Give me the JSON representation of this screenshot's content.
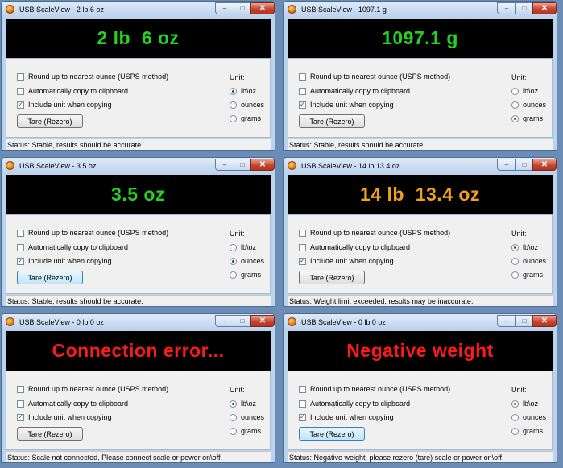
{
  "windows": [
    {
      "title": "USB ScaleView - 2 lb 6 oz",
      "display_text": "2 lb  6 oz",
      "display_color": "#22d322",
      "checkbox_round_label": "Round up to nearest ounce (USPS method)",
      "checkbox_round_checked": false,
      "checkbox_copy_label": "Automatically copy to clipboard",
      "checkbox_copy_checked": false,
      "checkbox_unit_label": "Include unit when copying",
      "checkbox_unit_checked": true,
      "unit_label": "Unit:",
      "radio_lboz_label": "lb\\oz",
      "radio_ounces_label": "ounces",
      "radio_grams_label": "grams",
      "selected_unit": "lb\\oz",
      "tare_label": "Tare (Rezero)",
      "status": "Status: Stable, results should be accurate."
    },
    {
      "title": "USB ScaleView - 1097.1 g",
      "display_text": "1097.1 g",
      "display_color": "#22d322",
      "checkbox_round_label": "Round up to nearest ounce (USPS method)",
      "checkbox_round_checked": false,
      "checkbox_copy_label": "Automatically copy to clipboard",
      "checkbox_copy_checked": false,
      "checkbox_unit_label": "Include unit when copying",
      "checkbox_unit_checked": true,
      "unit_label": "Unit:",
      "radio_lboz_label": "lb\\oz",
      "radio_ounces_label": "ounces",
      "radio_grams_label": "grams",
      "selected_unit": "grams",
      "tare_label": "Tare (Rezero)",
      "status": "Status: Stable, results should be accurate."
    },
    {
      "title": "USB ScaleView - 3.5 oz",
      "display_text": "3.5 oz",
      "display_color": "#22d322",
      "checkbox_round_label": "Round up to nearest ounce (USPS method)",
      "checkbox_round_checked": false,
      "checkbox_copy_label": "Automatically copy to clipboard",
      "checkbox_copy_checked": false,
      "checkbox_unit_label": "Include unit when copying",
      "checkbox_unit_checked": true,
      "unit_label": "Unit:",
      "radio_lboz_label": "lb\\oz",
      "radio_ounces_label": "ounces",
      "radio_grams_label": "grams",
      "selected_unit": "ounces",
      "tare_label": "Tare (Rezero)",
      "status": "Status: Stable, results should be accurate."
    },
    {
      "title": "USB ScaleView - 14 lb 13.4 oz",
      "display_text": "14 lb  13.4 oz",
      "display_color": "#f4a11a",
      "checkbox_round_label": "Round up to nearest ounce (USPS method)",
      "checkbox_round_checked": false,
      "checkbox_copy_label": "Automatically copy to clipboard",
      "checkbox_copy_checked": false,
      "checkbox_unit_label": "Include unit when copying",
      "checkbox_unit_checked": true,
      "unit_label": "Unit:",
      "radio_lboz_label": "lb\\oz",
      "radio_ounces_label": "ounces",
      "radio_grams_label": "grams",
      "selected_unit": "lb\\oz",
      "tare_label": "Tare (Rezero)",
      "status": "Status: Weight limit exceeded, results may be inaccurate."
    },
    {
      "title": "USB ScaleView - 0 lb 0 oz",
      "display_text": "Connection error...",
      "display_color": "#ff1a1a",
      "checkbox_round_label": "Round up to nearest ounce (USPS method)",
      "checkbox_round_checked": false,
      "checkbox_copy_label": "Automatically copy to clipboard",
      "checkbox_copy_checked": false,
      "checkbox_unit_label": "Include unit when copying",
      "checkbox_unit_checked": true,
      "unit_label": "Unit:",
      "radio_lboz_label": "lb\\oz",
      "radio_ounces_label": "ounces",
      "radio_grams_label": "grams",
      "selected_unit": "lb\\oz",
      "tare_label": "Tare (Rezero)",
      "status": "Status: Scale not connected. Please connect scale or power on\\off."
    },
    {
      "title": "USB ScaleView - 0 lb 0 oz",
      "display_text": "Negative weight",
      "display_color": "#ff1a1a",
      "checkbox_round_label": "Round up to nearest ounce (USPS method)",
      "checkbox_round_checked": false,
      "checkbox_copy_label": "Automatically copy to clipboard",
      "checkbox_copy_checked": false,
      "checkbox_unit_label": "Include unit when copying",
      "checkbox_unit_checked": true,
      "unit_label": "Unit:",
      "radio_lboz_label": "lb\\oz",
      "radio_ounces_label": "ounces",
      "radio_grams_label": "grams",
      "selected_unit": "lb\\oz",
      "tare_label": "Tare (Rezero)",
      "status": "Status: Negative weight, please rezero (tare) scale or power on\\off."
    }
  ]
}
